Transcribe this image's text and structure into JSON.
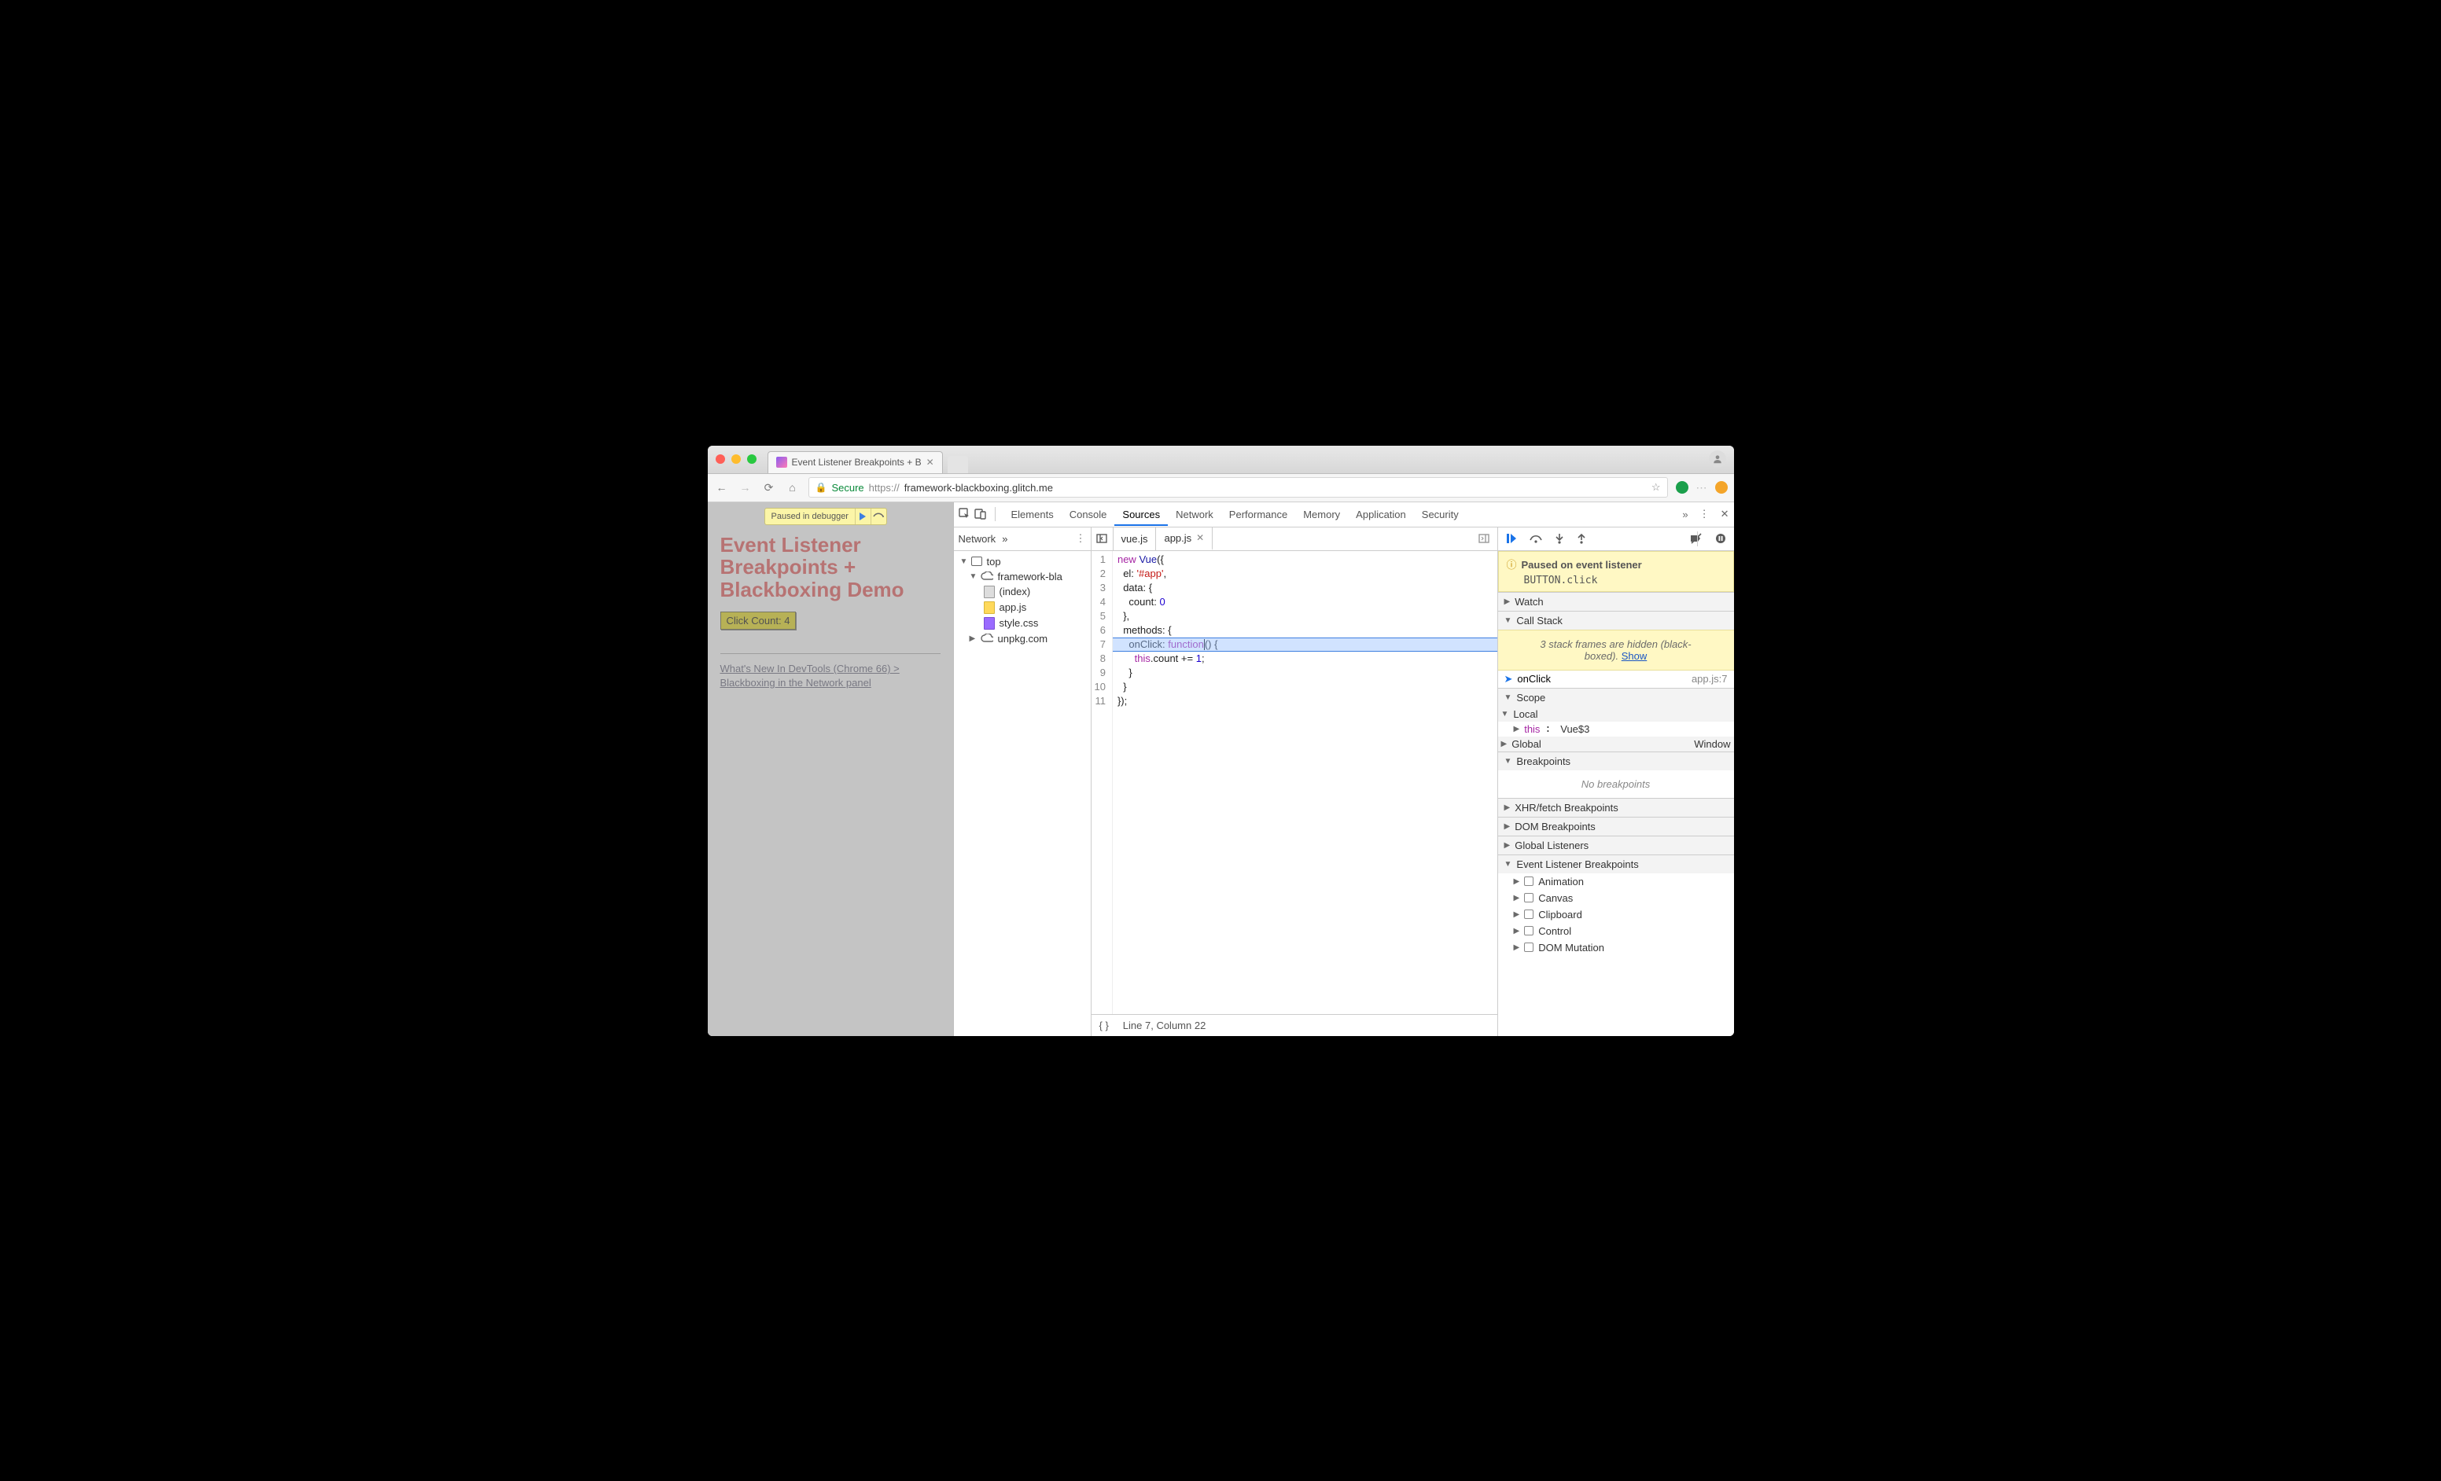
{
  "browser": {
    "tab_title": "Event Listener Breakpoints + B",
    "secure_label": "Secure",
    "url_host": "https://",
    "url_domain": "framework-blackboxing.glitch.me"
  },
  "page": {
    "paused_label": "Paused in debugger",
    "heading": "Event Listener Breakpoints + Blackboxing Demo",
    "button_prefix": "Click Count: ",
    "button_count": 4,
    "link_text": "What's New In DevTools (Chrome 66) > Blackboxing in the Network panel"
  },
  "devtools": {
    "tabs": [
      "Elements",
      "Console",
      "Sources",
      "Network",
      "Performance",
      "Memory",
      "Application",
      "Security"
    ],
    "active_tab": "Sources",
    "nav": {
      "tab": "Network",
      "tree": {
        "top": "top",
        "domain": "framework-bla",
        "files": [
          "(index)",
          "app.js",
          "style.css"
        ],
        "ext": "unpkg.com"
      }
    },
    "editor": {
      "tabs": [
        "vue.js",
        "app.js"
      ],
      "active": "app.js",
      "lines": [
        "new Vue({",
        "  el: '#app',",
        "  data: {",
        "    count: 0",
        "  },",
        "  methods: {",
        "    onClick: function() {",
        "      this.count += 1;",
        "    }",
        "  }",
        "});"
      ],
      "status": "Line 7, Column 22",
      "highlight_line": 7
    },
    "debugger": {
      "paused_title": "Paused on event listener",
      "paused_detail": "BUTTON.click",
      "watch": "Watch",
      "callstack_label": "Call Stack",
      "blackbox_note": "3 stack frames are hidden (black-boxed).",
      "show": "Show",
      "stack": [
        {
          "name": "onClick",
          "loc": "app.js:7"
        }
      ],
      "scope_label": "Scope",
      "scope": {
        "local_label": "Local",
        "this_label": "this",
        "this_val": "Vue$3",
        "global_label": "Global",
        "global_val": "Window"
      },
      "breakpoints_label": "Breakpoints",
      "no_breakpoints": "No breakpoints",
      "xhr": "XHR/fetch Breakpoints",
      "dom": "DOM Breakpoints",
      "gl": "Global Listeners",
      "elb": "Event Listener Breakpoints",
      "elb_items": [
        "Animation",
        "Canvas",
        "Clipboard",
        "Control",
        "DOM Mutation"
      ]
    }
  }
}
